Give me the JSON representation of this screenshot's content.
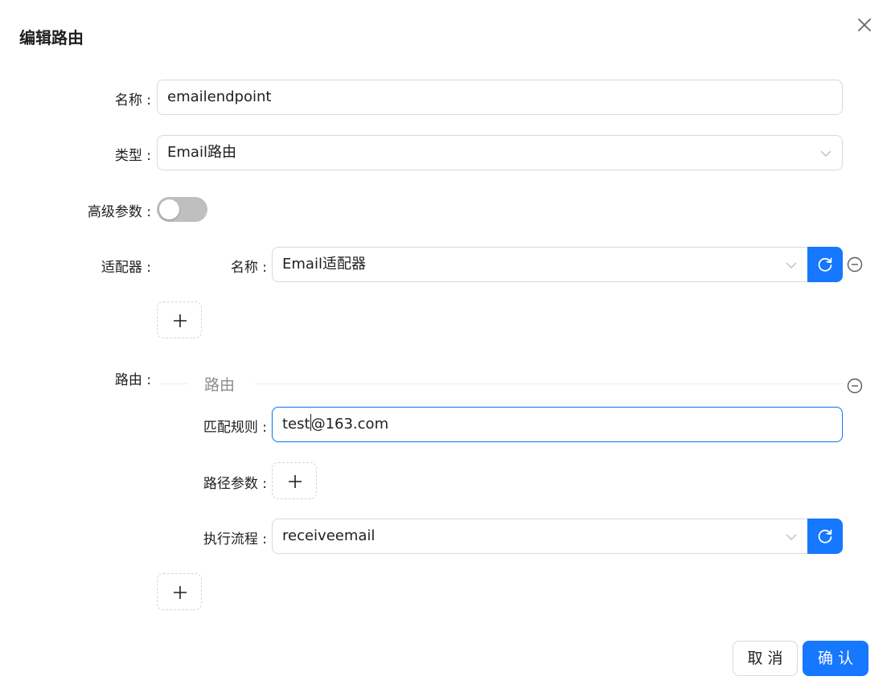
{
  "dialog": {
    "title": "编辑路由"
  },
  "form": {
    "name_label": "名称 :",
    "name_value": "emailendpoint",
    "type_label": "类型 :",
    "type_value": "Email路由",
    "advanced_label": "高级参数 :",
    "advanced_enabled": false,
    "adapter_label": "适配器 :",
    "adapter_name_label": "名称 :",
    "adapter_name_value": "Email适配器",
    "route_label": "路由 :",
    "route_divider_title": "路由",
    "match_rule_label": "匹配规则 :",
    "match_rule_value_before_cursor": "test",
    "match_rule_value_after_cursor": "@163.com",
    "path_params_label": "路径参数 :",
    "exec_flow_label": "执行流程 :",
    "exec_flow_value": "receiveemail"
  },
  "footer": {
    "cancel_label": "取消",
    "ok_label": "确认"
  },
  "colors": {
    "primary": "#1677ff",
    "toggle_off": "#bfbfbf",
    "border": "#d9d9d9"
  },
  "icons": [
    "close-icon",
    "chevron-down-icon",
    "refresh-icon",
    "minus-circle-icon",
    "plus-icon"
  ]
}
